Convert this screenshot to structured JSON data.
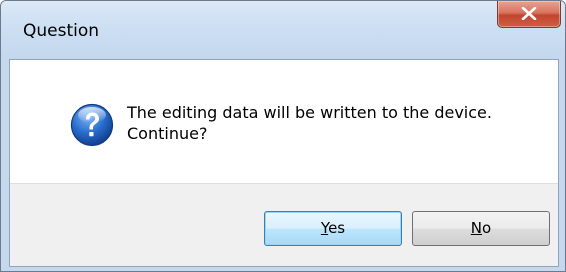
{
  "dialog": {
    "title": "Question",
    "message_line1": "The editing data will be written to the device.",
    "message_line2": "Continue?",
    "icon": "question-icon"
  },
  "buttons": {
    "yes": {
      "mnemonic": "Y",
      "rest": "es"
    },
    "no": {
      "mnemonic": "N",
      "rest": "o"
    },
    "close_icon": "close-icon"
  },
  "colors": {
    "titlebar": "#cddff2",
    "close_button": "#c2462e",
    "default_button_border": "#3c7fb1",
    "icon_blue": "#1f5fbf"
  }
}
